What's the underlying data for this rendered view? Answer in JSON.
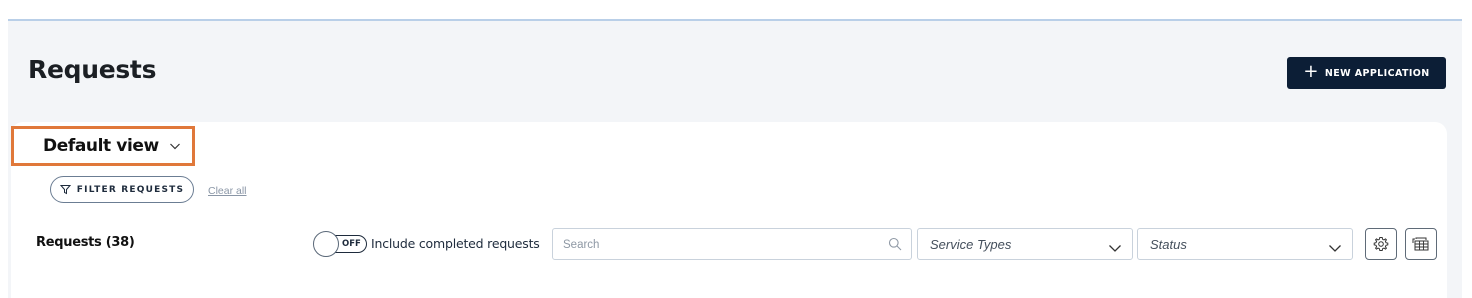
{
  "header": {
    "title": "Requests",
    "new_application_label": "NEW APPLICATION",
    "new_application_icon": "plus-icon"
  },
  "view": {
    "selected": "Default view"
  },
  "filters": {
    "filter_button_label": "FILTER REQUESTS",
    "clear_all_label": "Clear all"
  },
  "toolbar": {
    "requests_count_label": "Requests (38)",
    "toggle_state": "OFF",
    "toggle_label": "Include completed requests",
    "search_placeholder": "Search",
    "service_types_placeholder": "Service Types",
    "status_placeholder": "Status",
    "settings_icon": "gear-icon",
    "export_icon": "export-table-icon"
  },
  "colors": {
    "primary": "#0c1e36",
    "highlight": "#e0783a",
    "page_bg": "#f3f5f8"
  }
}
